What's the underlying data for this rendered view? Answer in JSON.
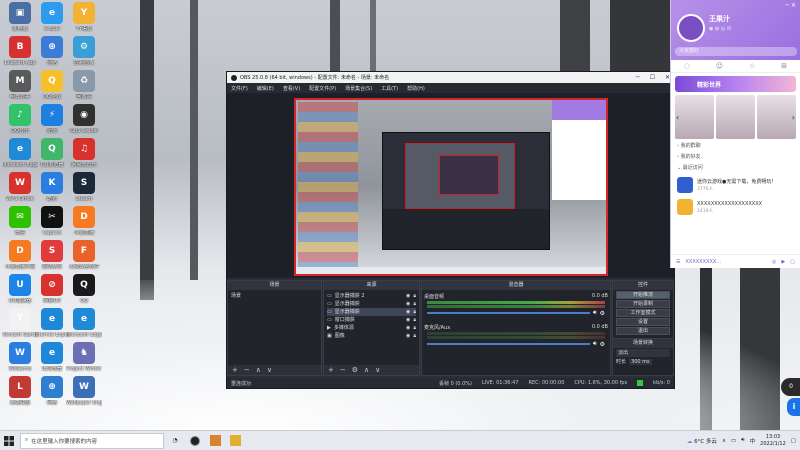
{
  "desktop_icons": [
    {
      "label": "此电脑",
      "color": "#4a6fa5",
      "glyph": "▣",
      "name": "this-pc-icon"
    },
    {
      "label": "e-ECO",
      "color": "#2d9bf0",
      "glyph": "e",
      "name": "eco-icon"
    },
    {
      "label": "YY语音",
      "color": "#f2b233",
      "glyph": "Y",
      "name": "yy-icon"
    },
    {
      "label": "Blizzard App",
      "color": "#d63131",
      "glyph": "B",
      "name": "blizzard-icon"
    },
    {
      "label": "网络",
      "color": "#3b7cd6",
      "glyph": "⊕",
      "name": "network-icon"
    },
    {
      "label": "控制面板",
      "color": "#3a9fd8",
      "glyph": "⚙",
      "name": "control-panel-icon"
    },
    {
      "label": "明日方舟",
      "color": "#5a5a5a",
      "glyph": "M",
      "name": "arknights-icon"
    },
    {
      "label": "QQ游戏",
      "color": "#f5c02b",
      "glyph": "Q",
      "name": "qqgame-icon"
    },
    {
      "label": "回收站",
      "color": "#8899aa",
      "glyph": "♻",
      "name": "recycle-bin-icon"
    },
    {
      "label": "QQ音乐",
      "color": "#32c26b",
      "glyph": "♪",
      "name": "qqmusic-icon"
    },
    {
      "label": "迅雷",
      "color": "#1d7fe0",
      "glyph": "⚡",
      "name": "thunder-icon"
    },
    {
      "label": "OBS Studio",
      "color": "#303030",
      "glyph": "◉",
      "name": "obs-icon"
    },
    {
      "label": "Microsoft Edge",
      "color": "#1f8ad6",
      "glyph": "e",
      "name": "edge-icon"
    },
    {
      "label": "QQ浏览器",
      "color": "#3fb66a",
      "glyph": "Q",
      "name": "qqbrowser-icon"
    },
    {
      "label": "网易云音乐",
      "color": "#d7322e",
      "glyph": "♫",
      "name": "netease-music-icon"
    },
    {
      "label": "WPS Office",
      "color": "#d7322e",
      "glyph": "W",
      "name": "wps-icon"
    },
    {
      "label": "酷狗",
      "color": "#2a7de1",
      "glyph": "K",
      "name": "kugou-icon"
    },
    {
      "label": "Steam",
      "color": "#1b2838",
      "glyph": "S",
      "name": "steam-icon"
    },
    {
      "label": "微信",
      "color": "#2dc100",
      "glyph": "✉",
      "name": "wechat-icon"
    },
    {
      "label": "CapCut",
      "color": "#111111",
      "glyph": "✂",
      "name": "capcut-icon"
    },
    {
      "label": "斗鱼直播",
      "color": "#f57a22",
      "glyph": "D",
      "name": "douyu-icon"
    },
    {
      "label": "斗鱼直播伴侣",
      "color": "#f57a22",
      "glyph": "D",
      "name": "douyu-companion-icon"
    },
    {
      "label": "驱动精灵",
      "color": "#e23b3b",
      "glyph": "S",
      "name": "driver-icon"
    },
    {
      "label": "火绒安全软件",
      "color": "#e8622a",
      "glyph": "F",
      "name": "huorong-icon"
    },
    {
      "label": "UU加速器",
      "color": "#1d84e8",
      "glyph": "U",
      "name": "uu-icon"
    },
    {
      "label": "网易UU",
      "color": "#d7322e",
      "glyph": "⊘",
      "name": "netease-uu-icon"
    },
    {
      "label": "QQ",
      "color": "#1a1a1a",
      "glyph": "Q",
      "name": "qq-icon"
    },
    {
      "label": "Tencent Games",
      "color": "#f2f2f2",
      "glyph": "T",
      "name": "tencent-games-icon"
    },
    {
      "label": "Internet Explorer",
      "color": "#1e88d8",
      "glyph": "e",
      "name": "ie-icon"
    },
    {
      "label": "Microsoft Edge",
      "color": "#1f8ad6",
      "glyph": "e",
      "name": "edge2-icon"
    },
    {
      "label": "WeGame",
      "color": "#2a7de1",
      "glyph": "W",
      "name": "wegame-icon"
    },
    {
      "label": "IE浏览器",
      "color": "#1e88d8",
      "glyph": "e",
      "name": "ie2-icon"
    },
    {
      "label": "Project Winter",
      "color": "#6c6fb3",
      "glyph": "♞",
      "name": "project-winter-icon"
    },
    {
      "label": "英雄联盟",
      "color": "#c23a34",
      "glyph": "L",
      "name": "lol-icon"
    },
    {
      "label": "网络",
      "color": "#2f7fd1",
      "glyph": "⊕",
      "name": "network2-icon"
    },
    {
      "label": "Wallpaper Engine",
      "color": "#3b6fb6",
      "glyph": "W",
      "name": "wallpaper-icon"
    },
    {
      "label": "Among Us",
      "color": "#d12a2a",
      "glyph": "A",
      "name": "among-us-icon"
    }
  ],
  "obs": {
    "title": "OBS 25.0.8 (64 bit, windows) - 配置文件: 未命名 - 场景: 未命名",
    "menu": [
      "文件(F)",
      "编辑(E)",
      "查看(V)",
      "配置文件(P)",
      "场景集合(S)",
      "工具(T)",
      "帮助(H)"
    ],
    "panels": {
      "scenes_title": "场景",
      "sources_title": "来源",
      "mixer_title": "混音器",
      "transitions_title": "场景转换",
      "controls_title": "控件"
    },
    "scenes": [
      "场景"
    ],
    "sources": [
      "显示器捕获 2",
      "显示器捕获",
      "显示器捕获",
      "窗口捕获",
      "多媒体源",
      "图像"
    ],
    "mixer": [
      {
        "name": "桌面音频",
        "level": "0.0 dB"
      },
      {
        "name": "麦克风/Aux",
        "level": "0.0 dB"
      }
    ],
    "controls": [
      "开始推流",
      "开始录制",
      "工作室模式",
      "设置",
      "退出"
    ],
    "transition": {
      "type": "淡出",
      "duration_label": "时长",
      "duration": "300 ms"
    },
    "status": {
      "left": "重连成功",
      "dropped": "丢帧 0 (0.0%)",
      "live": "LIVE: 01:36:47",
      "rec": "REC: 00:00:00",
      "cpu": "CPU: 1.6%, 30.00 fps",
      "kbps": "kb/s: 0"
    }
  },
  "qq": {
    "name": "王果汁",
    "subtitle": "大家都好",
    "search_placeholder": "搜索",
    "banner": "精彩世界",
    "groups": [
      "我的群聊",
      "我的好友",
      "最近访问"
    ],
    "contacts": [
      {
        "name": "迷你云游戏●无需下载，免费畅玩!",
        "sub": "3776人",
        "color": "#3060d0"
      },
      {
        "name": "XXXXXXXXXXXXXXXXXXX",
        "sub": "1419人",
        "color": "#f2b233"
      }
    ],
    "footer": "XXXXXXXXX..."
  },
  "taskbar": {
    "search_placeholder": "在这里输入你要搜索的内容",
    "weather": "6°C 多云",
    "ime": "中",
    "time": "13:03",
    "date": "2022/1/12"
  },
  "side_badges": {
    "first": "0",
    "second": "i"
  }
}
